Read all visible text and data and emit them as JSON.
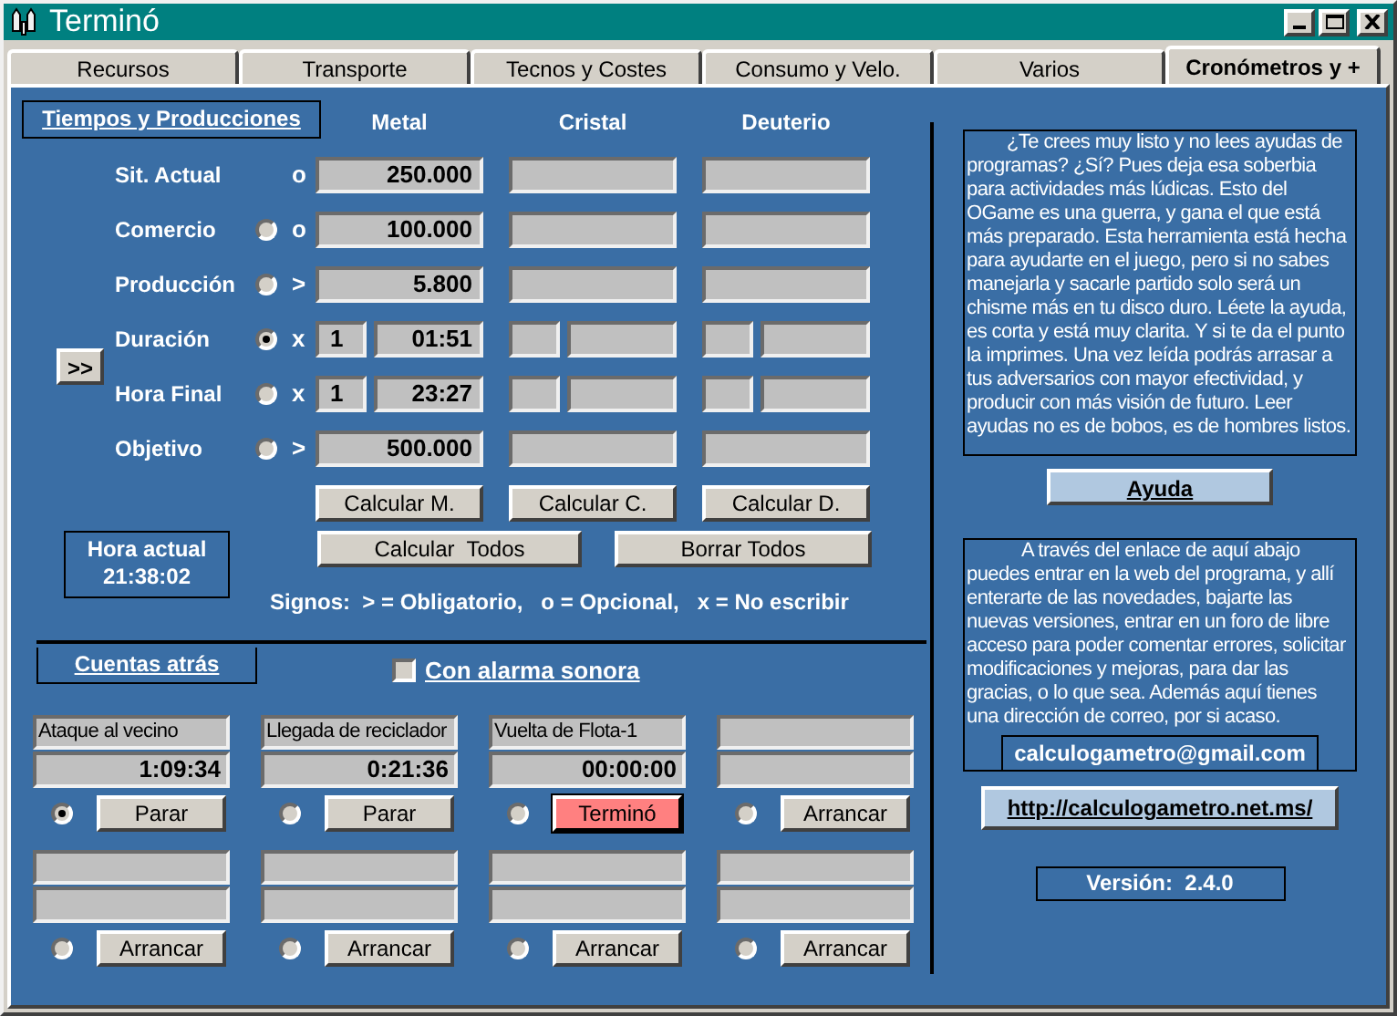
{
  "window": {
    "title": "Terminó"
  },
  "tabs": [
    {
      "label": "Recursos",
      "selected": false
    },
    {
      "label": "Transporte",
      "selected": false
    },
    {
      "label": "Tecnos y Costes",
      "selected": false
    },
    {
      "label": "Consumo y Velo.",
      "selected": false
    },
    {
      "label": "Varios",
      "selected": false
    },
    {
      "label": "Cronómetros y +",
      "selected": true
    }
  ],
  "production": {
    "title": "Tiempos y Producciones",
    "expand_button": ">>",
    "columns": [
      "Metal",
      "Cristal",
      "Deuterio"
    ],
    "rows": [
      {
        "label": "Sit. Actual",
        "sign": "o",
        "kind": "amount",
        "metal": "250.000"
      },
      {
        "label": "Comercio",
        "sign": "o",
        "kind": "amount",
        "selected": false,
        "metal": "100.000"
      },
      {
        "label": "Producción",
        "sign": ">",
        "kind": "amount",
        "selected": false,
        "metal": "5.800"
      },
      {
        "label": "Duración",
        "sign": "x",
        "kind": "time",
        "selected": true,
        "metal": {
          "days": "1",
          "time": "01:51"
        }
      },
      {
        "label": "Hora Final",
        "sign": "x",
        "kind": "time",
        "selected": false,
        "metal": {
          "days": "1",
          "time": "23:27"
        }
      },
      {
        "label": "Objetivo",
        "sign": ">",
        "kind": "amount",
        "selected": false,
        "metal": "500.000"
      }
    ],
    "calc_buttons": [
      "Calcular M.",
      "Calcular C.",
      "Calcular D."
    ],
    "bulk_buttons": [
      "Calcular  Todos",
      "Borrar Todos"
    ],
    "clock": {
      "label": "Hora actual",
      "time": "21:38:02"
    },
    "legend": "Signos:  > = Obligatorio,   o = Opcional,   x = No escribir"
  },
  "countdowns": {
    "title": "Cuentas atrás",
    "alarm": {
      "label": "Con alarma sonora",
      "checked": false
    },
    "timers": [
      {
        "name": "Ataque al vecino",
        "time": "1:09:34",
        "selected": true,
        "button": "Parar",
        "finished": false
      },
      {
        "name": "Llegada de reciclador",
        "time": "0:21:36",
        "selected": false,
        "button": "Parar",
        "finished": false
      },
      {
        "name": "Vuelta de Flota-1",
        "time": "00:00:00",
        "selected": false,
        "button": "Terminó",
        "finished": true
      },
      {
        "selected": false,
        "button": "Arrancar",
        "finished": false
      },
      {
        "selected": false,
        "button": "Arrancar",
        "finished": false
      },
      {
        "selected": false,
        "button": "Arrancar",
        "finished": false
      },
      {
        "selected": false,
        "button": "Arrancar",
        "finished": false
      },
      {
        "selected": false,
        "button": "Arrancar",
        "finished": false
      }
    ]
  },
  "help": {
    "text": "¿Te crees muy listo y no lees ayudas de programas? ¿Sí? Pues deja esa soberbia para actividades más lúdicas. Esto del OGame es una guerra, y gana el que está más preparado. Esta herramienta está hecha para ayudarte en el juego, pero si no sabes manejarla y sacarle partido solo será un chisme más en tu disco duro.  Léete la ayuda, es corta y está muy clarita. Y si te da el punto la imprimes. Una vez leída podrás arrasar a tus adversarios con mayor efectividad, y producir con más visión de futuro.  Leer ayudas no es de bobos, es de hombres listos.",
    "button": "Ayuda"
  },
  "info": {
    "text": "A través del enlace de aquí abajo puedes entrar en la web del programa, y allí enterarte de las novedades, bajarte las nuevas versiones, entrar en un foro de libre acceso para poder comentar errores, solicitar modificaciones y mejoras, para dar las gracias, o lo que sea.  Además aquí tienes una dirección de correo, por si acaso.",
    "email": "calculogametro@gmail.com"
  },
  "link": "http://calculogametro.net.ms/",
  "version": "Versión:  2.4.0"
}
